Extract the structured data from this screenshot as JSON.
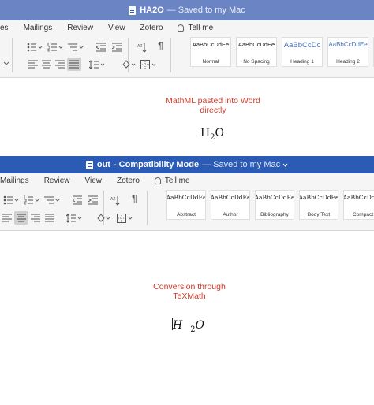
{
  "window1": {
    "title": "HA2O",
    "saved_status": "— Saved to my Mac",
    "menu": [
      "es",
      "Mailings",
      "Review",
      "View",
      "Zotero"
    ],
    "tell_me": "Tell me",
    "styles": [
      {
        "sample": "AaBbCcDdEe",
        "name": "Normal"
      },
      {
        "sample": "AaBbCcDdEe",
        "name": "No Spacing"
      },
      {
        "sample": "AaBbCcDc",
        "name": "Heading 1"
      },
      {
        "sample": "AaBbCcDdEe",
        "name": "Heading 2"
      }
    ],
    "caption_line1": "MathML pasted into Word",
    "caption_line2": "directly",
    "formula_main": "H",
    "formula_sub": "2",
    "formula_tail": "O"
  },
  "window2": {
    "title": "out",
    "mode": "- Compatibility Mode",
    "saved_status": "— Saved to my Mac",
    "menu": [
      "Mailings",
      "Review",
      "View",
      "Zotero"
    ],
    "tell_me": "Tell me",
    "styles": [
      {
        "sample": "AaBbCcDdEe",
        "name": "Abstract"
      },
      {
        "sample": "AaBbCcDdEe",
        "name": "Author"
      },
      {
        "sample": "AaBbCcDdEe",
        "name": "Bibliography"
      },
      {
        "sample": "AaBbCcDdEe",
        "name": "Body Text"
      },
      {
        "sample": "AaBbCcDdEe",
        "name": "Compact"
      }
    ],
    "caption_line1": "Conversion through",
    "caption_line2": "TeXMath",
    "formula_main": "H",
    "formula_sub": "2",
    "formula_tail": "O"
  },
  "colors": {
    "titlebar_inactive": "#6b85c4",
    "titlebar_active": "#2b5bb5",
    "caption": "#d03a2a"
  },
  "icons": [
    "document-icon",
    "lightbulb-icon",
    "bullets-icon",
    "numbering-icon",
    "multilevel-list-icon",
    "decrease-indent-icon",
    "increase-indent-icon",
    "sort-icon",
    "pilcrow-icon",
    "align-left-icon",
    "align-center-icon",
    "align-right-icon",
    "justify-icon",
    "line-spacing-icon",
    "shading-icon",
    "borders-icon"
  ]
}
